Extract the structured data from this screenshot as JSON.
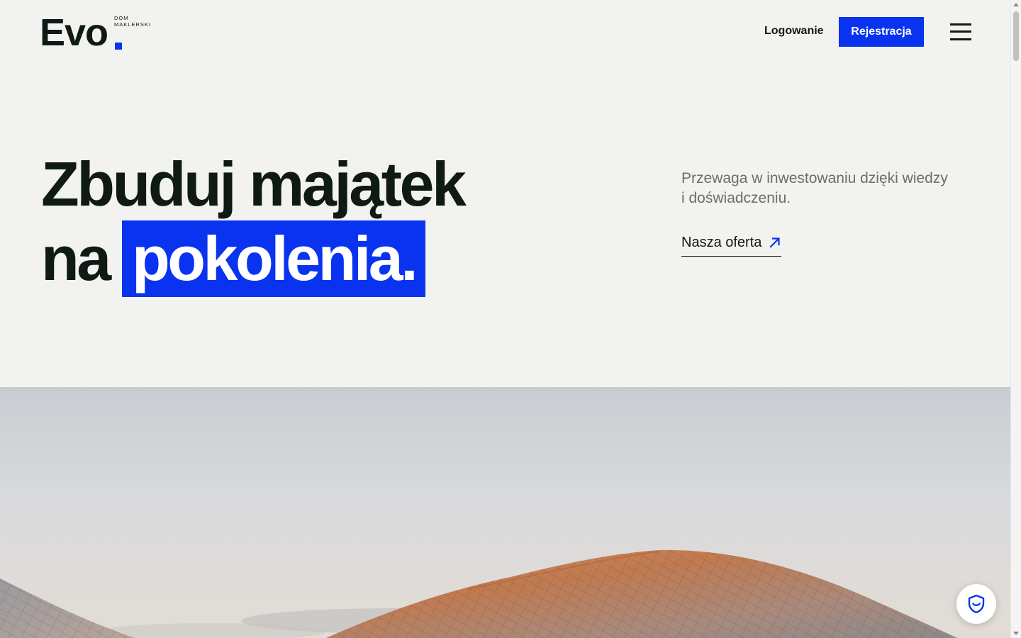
{
  "header": {
    "logo": {
      "word": "Evo",
      "subtitle_line1": "DOM",
      "subtitle_line2": "MAKLERSKI"
    },
    "login_label": "Logowanie",
    "register_label": "Rejestracja",
    "menu_icon": "hamburger-menu-icon"
  },
  "hero": {
    "headline_line1": "Zbuduj majątek",
    "headline_line2_prefix": "na",
    "headline_highlight": "pokolenia.",
    "lead_line1": "Przewaga w inwestowaniu dzięki wiedzy",
    "lead_line2": "i doświadczeniu.",
    "offer_link_label": "Nasza oferta",
    "offer_link_icon": "arrow-up-right-icon"
  },
  "widgets": {
    "privacy_icon": "shield-icon"
  },
  "colors": {
    "accent": "#0a33f0",
    "background": "#f2f2f0",
    "text": "#0f1a14",
    "muted_text": "#6d6d69"
  }
}
